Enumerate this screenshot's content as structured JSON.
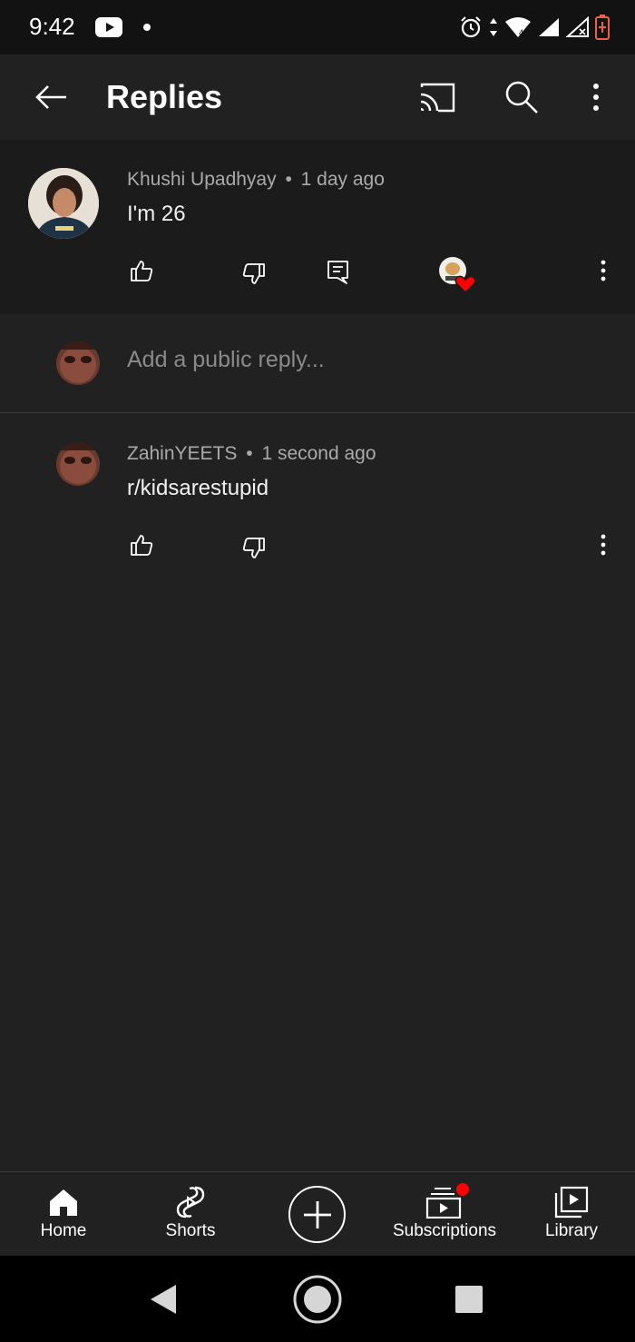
{
  "status_bar": {
    "time": "9:42",
    "icons": [
      "youtube-icon",
      "alarm-icon",
      "wifi-icon",
      "signal-icon",
      "battery-icon"
    ]
  },
  "app_bar": {
    "title": "Replies",
    "icons": [
      "back-arrow-icon",
      "cast-icon",
      "search-icon",
      "more-vert-icon"
    ]
  },
  "parent_comment": {
    "author": "Khushi Upadhyay",
    "age": "1 day ago",
    "separator": "•",
    "text": "I'm 26",
    "actions": [
      "like-icon",
      "dislike-icon",
      "reply-icon",
      "creator-heart-icon",
      "more-vert-icon"
    ]
  },
  "reply_box": {
    "placeholder": "Add a public reply..."
  },
  "replies": [
    {
      "author": "ZahinYEETS",
      "age": "1 second ago",
      "separator": "•",
      "text": "r/kidsarestupid"
    }
  ],
  "bottom_nav": {
    "items": [
      {
        "label": "Home",
        "icon": "home-icon"
      },
      {
        "label": "Shorts",
        "icon": "shorts-icon"
      },
      {
        "label": "",
        "icon": "create-plus-icon"
      },
      {
        "label": "Subscriptions",
        "icon": "subscriptions-icon"
      },
      {
        "label": "Library",
        "icon": "library-icon"
      }
    ]
  },
  "colors": {
    "background": "#212121",
    "parent_comment_bg": "#1b1b1b",
    "meta_text": "#aaaaaa",
    "notification_red": "#ff0000"
  }
}
